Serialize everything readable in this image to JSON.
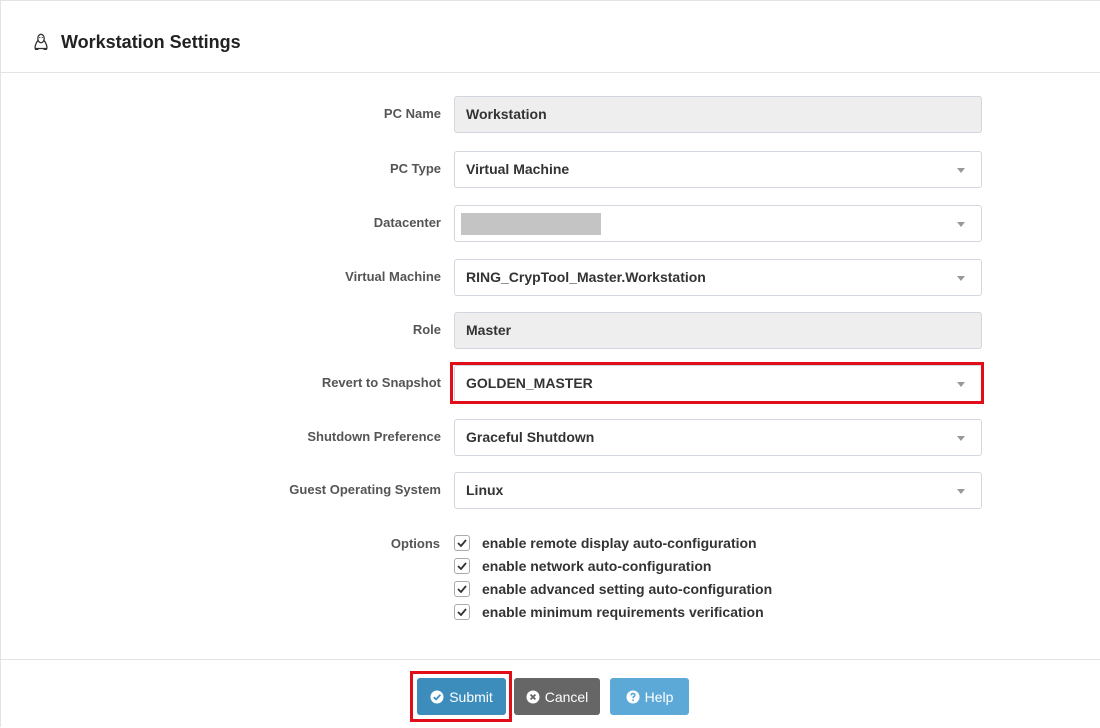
{
  "header": {
    "title": "Workstation Settings",
    "icon": "linux-penguin-icon"
  },
  "fields": {
    "pc_name": {
      "label": "PC Name",
      "value": "Workstation"
    },
    "pc_type": {
      "label": "PC Type",
      "value": "Virtual Machine"
    },
    "datacenter": {
      "label": "Datacenter",
      "value": ""
    },
    "virtual_machine": {
      "label": "Virtual Machine",
      "value": "RING_CrypTool_Master.Workstation"
    },
    "role": {
      "label": "Role",
      "value": "Master"
    },
    "revert_snapshot": {
      "label": "Revert to Snapshot",
      "value": "GOLDEN_MASTER"
    },
    "shutdown_pref": {
      "label": "Shutdown Preference",
      "value": "Graceful Shutdown"
    },
    "guest_os": {
      "label": "Guest Operating System",
      "value": "Linux"
    }
  },
  "options": {
    "label": "Options",
    "items": [
      {
        "label": "enable remote display auto-configuration",
        "checked": true
      },
      {
        "label": "enable network auto-configuration",
        "checked": true
      },
      {
        "label": "enable advanced setting auto-configuration",
        "checked": true
      },
      {
        "label": "enable minimum requirements verification",
        "checked": true
      }
    ]
  },
  "buttons": {
    "submit": "Submit",
    "cancel": "Cancel",
    "help": "Help"
  },
  "colors": {
    "highlight": "#e10e1a",
    "submit": "#3c8dbc",
    "cancel": "#666666",
    "help": "#5ca9d8"
  }
}
